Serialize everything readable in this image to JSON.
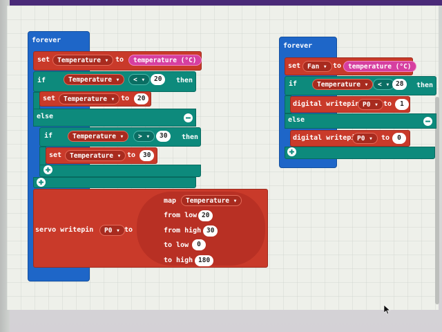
{
  "colors": {
    "event_blue": "#1e66c8",
    "logic_teal": "#0d8a7c",
    "var_red": "#c93a2a",
    "sensor_pink": "#d63fa0"
  },
  "left_program": {
    "forever_label": "forever",
    "set_label": "set",
    "set_var": "Temperature ▾",
    "to_label": "to",
    "sensor": "temperature (°C)",
    "if_label": "if",
    "cond_var": "Temperature ▾",
    "op1": "< ▾",
    "cond_val": "20",
    "then_label": "then",
    "inner_set_label": "set",
    "inner_set_var": "Temperature ▾",
    "inner_to_label": "to",
    "inner_set_val": "20",
    "else_label": "else",
    "if2_label": "if",
    "cond2_var": "Temperature ▾",
    "op2": "> ▾",
    "cond2_val": "30",
    "then2_label": "then",
    "inner2_set_label": "set",
    "inner2_set_var": "Temperature ▾",
    "inner2_to_label": "to",
    "inner2_set_val": "30",
    "servo_label": "servo writepin",
    "servo_pin": "P0 ▾",
    "servo_to": "to",
    "map_label": "map",
    "map_var": "Temperature ▾",
    "from_low_label": "from low",
    "from_low_val": "20",
    "from_high_label": "from high",
    "from_high_val": "30",
    "to_low_label": "to low",
    "to_low_val": "0",
    "to_high_label": "to high",
    "to_high_val": "180"
  },
  "right_program": {
    "forever_label": "forever",
    "set_label": "set",
    "set_var": "Fan ▾",
    "to_label": "to",
    "sensor": "temperature (°C)",
    "if_label": "if",
    "cond_var": "Temperature ▾",
    "op": "< ▾",
    "cond_val": "28",
    "then_label": "then",
    "dw1_label": "digital writepin",
    "dw1_pin": "P0 ▾",
    "dw1_to": "to",
    "dw1_val": "1",
    "else_label": "else",
    "dw2_label": "digital writepin",
    "dw2_pin": "P0 ▾",
    "dw2_to": "to",
    "dw2_val": "0"
  }
}
